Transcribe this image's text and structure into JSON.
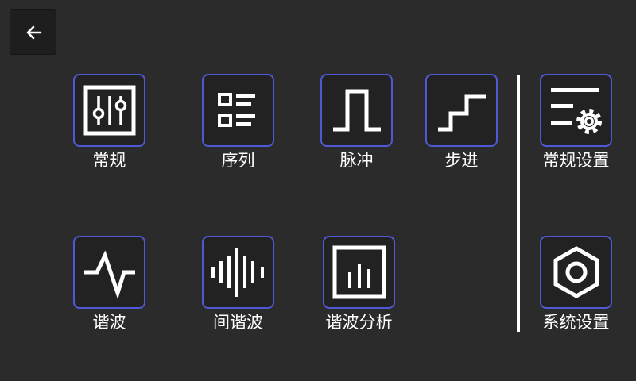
{
  "header": {
    "back_icon": "arrow-left-icon"
  },
  "modes": [
    {
      "label": "常规",
      "icon": "mixer-sliders-icon"
    },
    {
      "label": "序列",
      "icon": "list-icon"
    },
    {
      "label": "脉冲",
      "icon": "pulse-wave-icon"
    },
    {
      "label": "步进",
      "icon": "step-stairs-icon"
    },
    {
      "label": "谐波",
      "icon": "waveform-spike-icon"
    },
    {
      "label": "间谐波",
      "icon": "audio-bars-icon"
    },
    {
      "label": "谐波分析",
      "icon": "bar-chart-icon"
    }
  ],
  "settings": [
    {
      "label": "常规设置",
      "icon": "list-gear-icon"
    },
    {
      "label": "系统设置",
      "icon": "hexagon-nut-icon"
    }
  ],
  "colors": {
    "background": "#2b2b2b",
    "tile_border": "#4f59d6",
    "tile_fill": "#222222",
    "foreground": "#ffffff"
  }
}
